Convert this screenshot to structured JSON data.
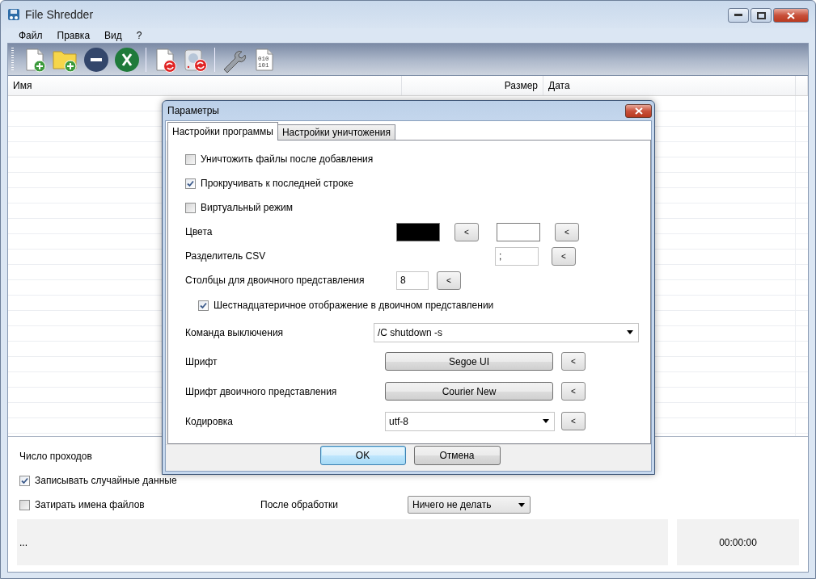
{
  "window": {
    "title": "File Shredder"
  },
  "menu": [
    "Файл",
    "Правка",
    "Вид",
    "?"
  ],
  "toolbar": [
    {
      "kind": "add-file"
    },
    {
      "kind": "add-folder"
    },
    {
      "kind": "remove"
    },
    {
      "kind": "clear"
    },
    {
      "kind": "separator"
    },
    {
      "kind": "file-refresh"
    },
    {
      "kind": "disk-refresh"
    },
    {
      "kind": "separator"
    },
    {
      "kind": "settings"
    },
    {
      "kind": "binary",
      "lines": [
        "010",
        "101"
      ]
    }
  ],
  "table": {
    "columns": [
      "Имя",
      "Размер",
      "Дата"
    ]
  },
  "options": {
    "passes_label": "Число проходов",
    "checks": [
      {
        "label": "Записывать случайные данные",
        "checked": true
      },
      {
        "label": "Затирать имена файлов",
        "checked": false
      }
    ],
    "after_label": "После обработки",
    "after_value": "Ничего не делать"
  },
  "status": {
    "message": "...",
    "time": "00:00:00"
  },
  "dialog": {
    "title": "Параметры",
    "tabs": [
      {
        "label": "Настройки программы",
        "selected": true
      },
      {
        "label": "Настройки уничтожения",
        "selected": false
      }
    ],
    "rows": [
      {
        "kind": "checkbox",
        "label": "Уничтожить файлы после добавления",
        "checked": false
      },
      {
        "kind": "checkbox",
        "label": "Прокручивать к последней строке",
        "checked": true
      },
      {
        "kind": "checkbox",
        "label": "Виртуальный режим",
        "checked": false
      },
      {
        "kind": "colors",
        "label": "Цвета",
        "swatches": [
          {
            "color": "#000000",
            "reset": "<"
          },
          {
            "color": "#ffffff",
            "reset": "<"
          }
        ]
      },
      {
        "kind": "field-offset",
        "label": "Разделитель CSV",
        "value": ";",
        "reset": "<"
      },
      {
        "kind": "field",
        "label": "Столбцы для двоичного представления",
        "value": "8",
        "reset": "<"
      },
      {
        "kind": "subcheckbox",
        "label": "Шестнадцатеричное отображение в двоичном представлении",
        "checked": true
      },
      {
        "kind": "dropdown",
        "label": "Команда выключения",
        "value": "/C shutdown -s"
      },
      {
        "kind": "font",
        "label": "Шрифт",
        "value": "Segoe UI",
        "reset": "<"
      },
      {
        "kind": "font",
        "label": "Шрифт двоичного представления",
        "value": "Courier New",
        "reset": "<"
      },
      {
        "kind": "dropdown",
        "label": "Кодировка",
        "value": "utf-8",
        "reset": "<"
      }
    ],
    "buttons": [
      {
        "label": "OK",
        "default": true
      },
      {
        "label": "Отмена",
        "default": false
      }
    ]
  }
}
